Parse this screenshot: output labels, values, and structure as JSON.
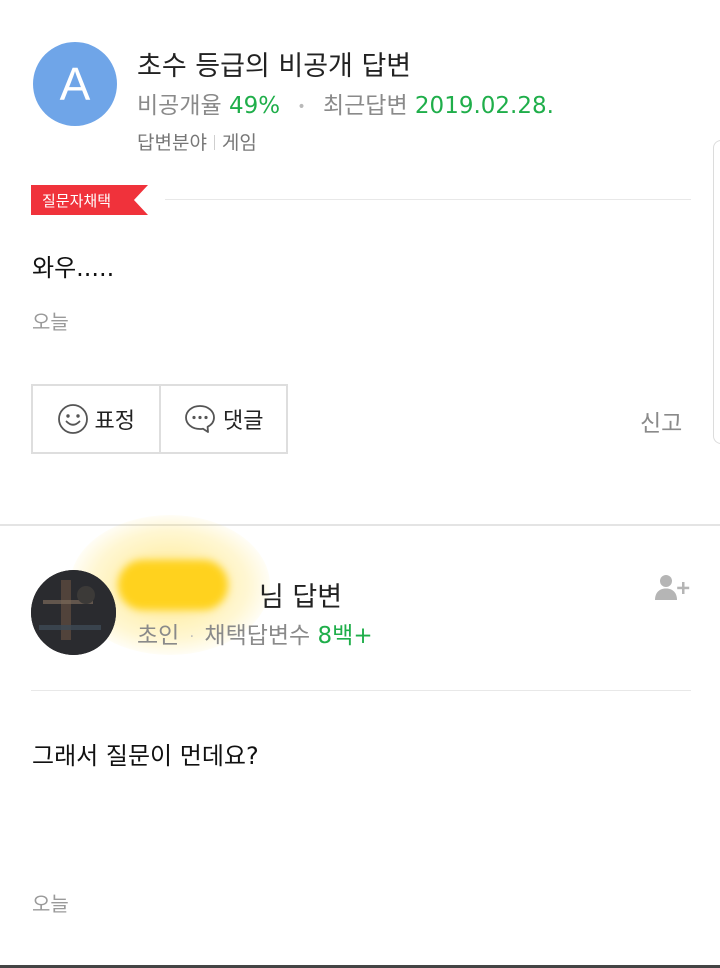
{
  "answer1": {
    "avatar_letter": "A",
    "title": "초수 등급의 비공개 답변",
    "stats": {
      "private_label": "비공개율",
      "private_value": "49%",
      "recent_label": "최근답변",
      "recent_value": "2019.02.28."
    },
    "field_label": "답변분야",
    "field_value": "게임",
    "badge": "질문자채택",
    "body": "와우.....",
    "time": "오늘",
    "buttons": {
      "emotion": "표정",
      "comment": "댓글"
    },
    "report": "신고"
  },
  "answer2": {
    "title_suffix": "님 답변",
    "stats": {
      "grade": "초인",
      "chosen_label": "채택답변수",
      "chosen_value": "8백+"
    },
    "body": "그래서 질문이 먼데요?",
    "time": "오늘"
  },
  "colors": {
    "accent_green": "#1fae4a",
    "badge_red": "#f0323b",
    "avatar_blue": "#6fa5e8"
  },
  "icons": [
    "smile-icon",
    "speech-bubble-icon",
    "add-friend-icon"
  ]
}
